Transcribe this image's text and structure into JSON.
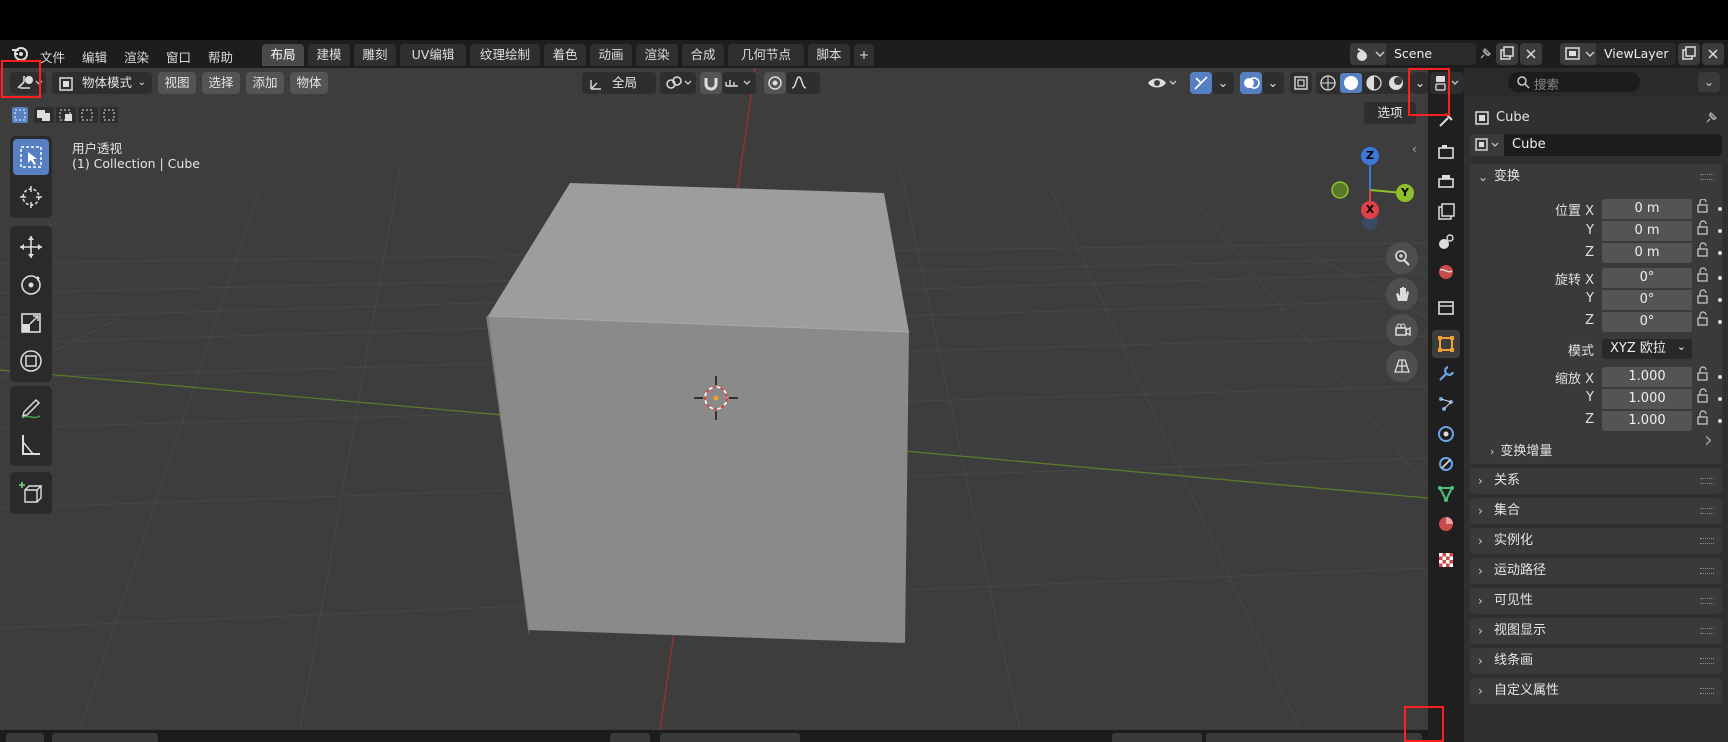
{
  "menubar": {
    "items": [
      "文件",
      "编辑",
      "渲染",
      "窗口",
      "帮助"
    ],
    "workspaces": [
      "布局",
      "建模",
      "雕刻",
      "UV编辑",
      "纹理绘制",
      "着色",
      "动画",
      "渲染",
      "合成",
      "几何节点",
      "脚本"
    ],
    "active_workspace": "布局",
    "add_tab": "+",
    "scene": "Scene",
    "view_layer": "ViewLayer"
  },
  "viewport_header": {
    "mode": "物体模式",
    "menus": [
      "视图",
      "选择",
      "添加",
      "物体"
    ],
    "transform_orientation": "全局",
    "options_label": "选项"
  },
  "viewport": {
    "view_name": "用户透视",
    "collection_info": "(1) Collection | Cube",
    "gizmo": {
      "z": "Z",
      "y": "Y",
      "x": "X"
    }
  },
  "properties": {
    "search_placeholder": "搜索",
    "object_name": "Cube",
    "object_field": "Cube",
    "transform": {
      "title": "变换",
      "location_label": "位置 X",
      "rotation_label": "旋转 X",
      "scale_label": "缩放 X",
      "y_label": "Y",
      "z_label": "Z",
      "location": [
        "0 m",
        "0 m",
        "0 m"
      ],
      "rotation": [
        "0°",
        "0°",
        "0°"
      ],
      "mode_label": "模式",
      "mode_value": "XYZ 欧拉",
      "scale": [
        "1.000",
        "1.000",
        "1.000"
      ],
      "delta": "变换增量"
    },
    "panels": [
      "关系",
      "集合",
      "实例化",
      "运动路径",
      "可见性",
      "视图显示",
      "线条画",
      "自定义属性"
    ]
  },
  "colors": {
    "accent": "#5680c2",
    "viewport_bg": "#3d3d3d",
    "highlight_box": "#ff1f1f",
    "axis_x": "#e0404a",
    "axis_y": "#8fbf2a",
    "axis_z": "#3c78d8"
  }
}
